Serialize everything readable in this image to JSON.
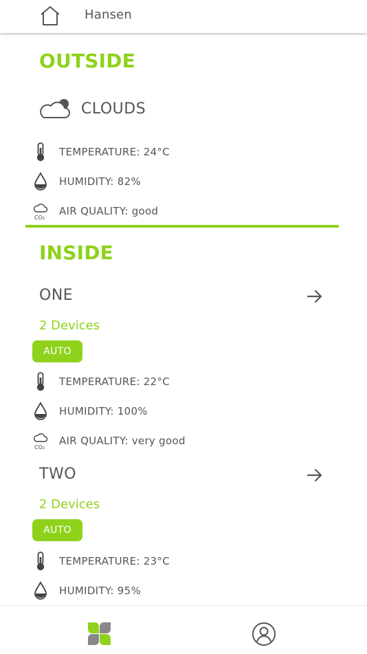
{
  "header": {
    "home_label": "Hansen"
  },
  "outside": {
    "title": "OUTSIDE",
    "weather": "CLOUDS",
    "metrics": [
      {
        "icon": "thermometer-icon",
        "label": "TEMPERATURE: 24°C"
      },
      {
        "icon": "humidity-drop-icon",
        "label": "HUMIDITY: 82%"
      },
      {
        "icon": "co2-cloud-icon",
        "label": "AIR QUALITY: good"
      }
    ]
  },
  "inside": {
    "title": "INSIDE",
    "rooms": [
      {
        "name": "ONE",
        "devices": "2 Devices",
        "mode": "AUTO",
        "metrics": [
          {
            "icon": "thermometer-icon",
            "label": "TEMPERATURE: 22°C"
          },
          {
            "icon": "humidity-drop-icon",
            "label": "HUMIDITY: 100%"
          },
          {
            "icon": "co2-cloud-icon",
            "label": "AIR QUALITY: very good"
          }
        ]
      },
      {
        "name": "TWO",
        "devices": "2 Devices",
        "mode": "AUTO",
        "metrics": [
          {
            "icon": "thermometer-icon",
            "label": "TEMPERATURE: 23°C"
          },
          {
            "icon": "humidity-drop-icon",
            "label": "HUMIDITY: 95%"
          }
        ]
      }
    ]
  },
  "nav": {
    "items": [
      "clover-home-icon",
      "profile-icon"
    ]
  },
  "colors": {
    "accent": "#8fd21b",
    "text": "#555555",
    "icon": "#444444"
  }
}
